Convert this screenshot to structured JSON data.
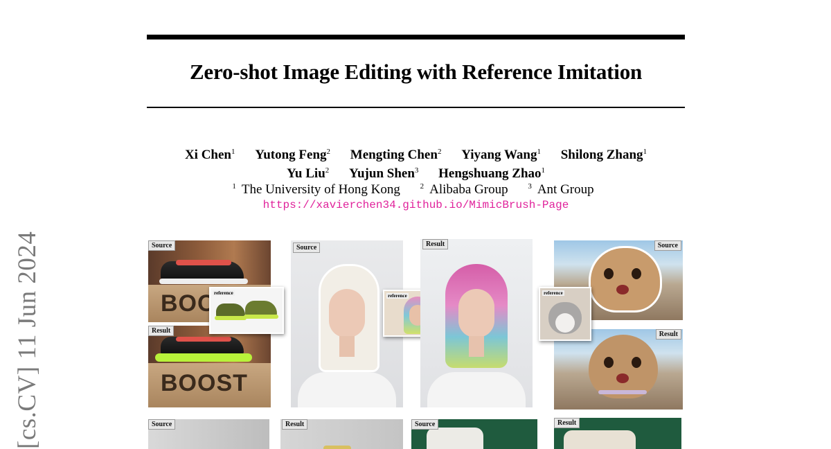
{
  "arxiv_stamp": "[cs.CV]  11 Jun 2024",
  "title": "Zero-shot Image Editing with Reference Imitation",
  "authors": [
    {
      "name": "Xi Chen",
      "aff": "1"
    },
    {
      "name": "Yutong Feng",
      "aff": "2"
    },
    {
      "name": "Mengting Chen",
      "aff": "2"
    },
    {
      "name": "Yiyang Wang",
      "aff": "1"
    },
    {
      "name": "Shilong Zhang",
      "aff": "1"
    },
    {
      "name": "Yu Liu",
      "aff": "2"
    },
    {
      "name": "Yujun Shen",
      "aff": "3"
    },
    {
      "name": "Hengshuang Zhao",
      "aff": "1"
    }
  ],
  "affiliations": [
    {
      "num": "1",
      "name": "The University of Hong Kong"
    },
    {
      "num": "2",
      "name": "Alibaba Group"
    },
    {
      "num": "3",
      "name": "Ant Group"
    }
  ],
  "url": "https://xavierchen34.github.io/MimicBrush-Page",
  "figure": {
    "labels": {
      "source": "Source",
      "result": "Result",
      "reference": "reference"
    },
    "shoe_box_text": "BOOST",
    "shoe_box_text_partial": "BOOS"
  }
}
